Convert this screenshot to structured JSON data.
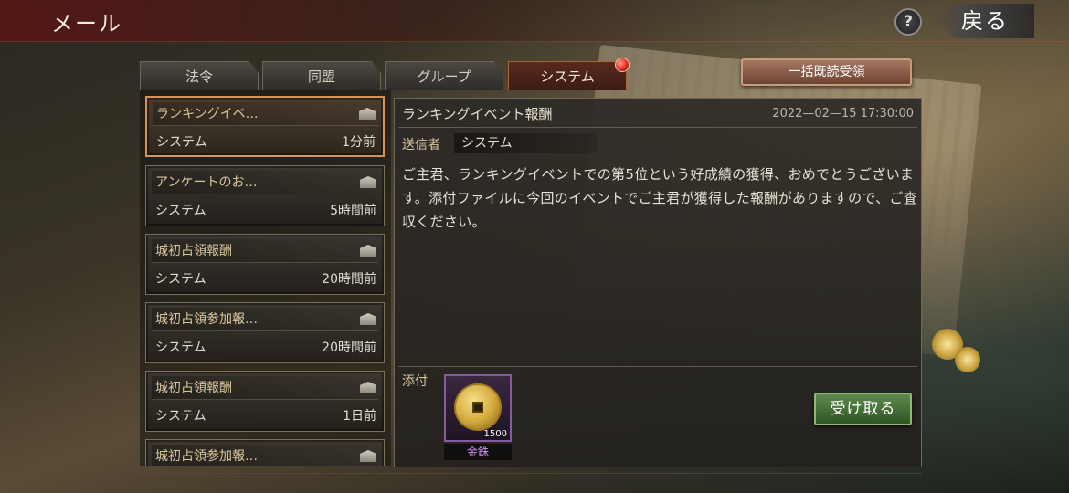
{
  "header": {
    "title": "メール",
    "help_label": "?",
    "back_label": "戻る"
  },
  "tabs": [
    {
      "label": "法令"
    },
    {
      "label": "同盟"
    },
    {
      "label": "グループ"
    },
    {
      "label": "システム",
      "active": true
    }
  ],
  "read_all_button": "一括既読受領",
  "mail_list": [
    {
      "subject": "ランキングイベ…",
      "sender": "システム",
      "time": "1分前",
      "selected": true
    },
    {
      "subject": "アンケートのお…",
      "sender": "システム",
      "time": "5時間前"
    },
    {
      "subject": "城初占領報酬",
      "sender": "システム",
      "time": "20時間前"
    },
    {
      "subject": "城初占領参加報…",
      "sender": "システム",
      "time": "20時間前"
    },
    {
      "subject": "城初占領報酬",
      "sender": "システム",
      "time": "1日前"
    },
    {
      "subject": "城初占領参加報…",
      "sender": "",
      "time": ""
    }
  ],
  "detail": {
    "subject": "ランキングイベント報酬",
    "date": "2022—02—15 17:30:00",
    "sender_label": "送信者",
    "sender": "システム",
    "body": "ご主君、ランキングイベントでの第5位という好成績の獲得、おめでとうございます。添付ファイルに今回のイベントでご主君が獲得した報酬がありますので、ご査収ください。",
    "attachment_label": "添付",
    "attachment": {
      "name": "金銖",
      "quantity": "1500",
      "icon": "gold-coin-icon"
    },
    "receive_button": "受け取る"
  },
  "colors": {
    "accent_gold": "#d8c79c",
    "active_tab": "#5a2a1e",
    "receive_green": "#4a7a3c",
    "notification_red": "#d8261a",
    "attachment_purple": "#8a5aa0"
  }
}
